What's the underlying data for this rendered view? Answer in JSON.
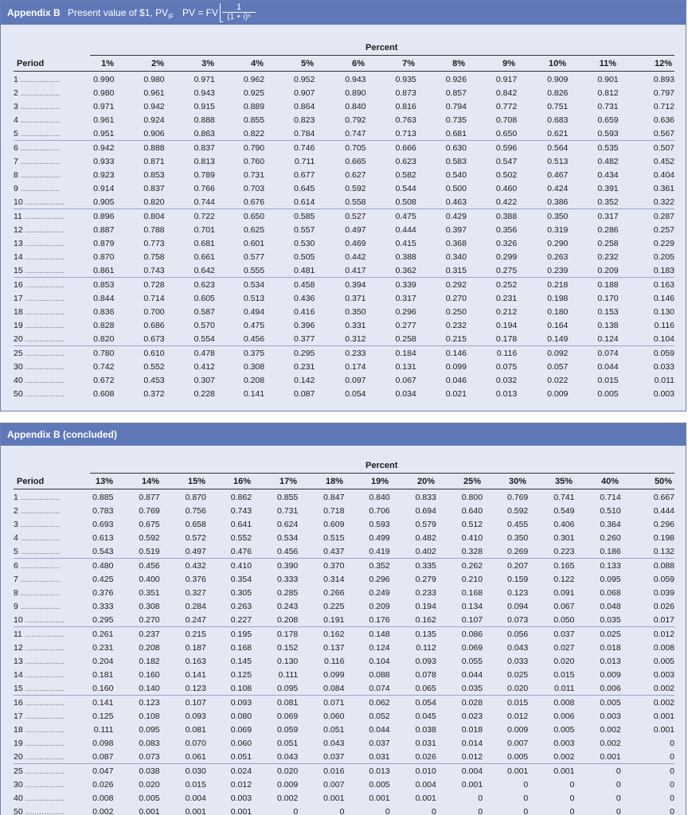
{
  "appendix1": {
    "title": "Appendix B",
    "subtitle": "Present value of $1, PV",
    "subtitle_sub": "IF",
    "formula_lhs": "PV = FV",
    "formula_num": "1",
    "formula_den": "(1 + i)ⁿ",
    "percent_label": "Percent",
    "period_label": "Period",
    "columns": [
      "1%",
      "2%",
      "3%",
      "4%",
      "5%",
      "6%",
      "7%",
      "8%",
      "9%",
      "10%",
      "11%",
      "12%"
    ],
    "rows": [
      {
        "p": "1",
        "v": [
          "0.990",
          "0.980",
          "0.971",
          "0.962",
          "0.952",
          "0.943",
          "0.935",
          "0.926",
          "0.917",
          "0.909",
          "0.901",
          "0.893"
        ]
      },
      {
        "p": "2",
        "v": [
          "0.980",
          "0.961",
          "0.943",
          "0.925",
          "0.907",
          "0.890",
          "0.873",
          "0.857",
          "0.842",
          "0.826",
          "0.812",
          "0.797"
        ]
      },
      {
        "p": "3",
        "v": [
          "0.971",
          "0.942",
          "0.915",
          "0.889",
          "0.864",
          "0.840",
          "0.816",
          "0.794",
          "0.772",
          "0.751",
          "0.731",
          "0.712"
        ]
      },
      {
        "p": "4",
        "v": [
          "0.961",
          "0.924",
          "0.888",
          "0.855",
          "0.823",
          "0.792",
          "0.763",
          "0.735",
          "0.708",
          "0.683",
          "0.659",
          "0.636"
        ]
      },
      {
        "p": "5",
        "v": [
          "0.951",
          "0.906",
          "0.863",
          "0.822",
          "0.784",
          "0.747",
          "0.713",
          "0.681",
          "0.650",
          "0.621",
          "0.593",
          "0.567"
        ]
      },
      {
        "p": "6",
        "v": [
          "0.942",
          "0.888",
          "0.837",
          "0.790",
          "0.746",
          "0.705",
          "0.666",
          "0.630",
          "0.596",
          "0.564",
          "0.535",
          "0.507"
        ]
      },
      {
        "p": "7",
        "v": [
          "0.933",
          "0.871",
          "0.813",
          "0.760",
          "0.711",
          "0.665",
          "0.623",
          "0.583",
          "0.547",
          "0.513",
          "0.482",
          "0.452"
        ]
      },
      {
        "p": "8",
        "v": [
          "0.923",
          "0.853",
          "0.789",
          "0.731",
          "0.677",
          "0.627",
          "0.582",
          "0.540",
          "0.502",
          "0.467",
          "0.434",
          "0.404"
        ]
      },
      {
        "p": "9",
        "v": [
          "0.914",
          "0.837",
          "0.766",
          "0.703",
          "0.645",
          "0.592",
          "0.544",
          "0.500",
          "0.460",
          "0.424",
          "0.391",
          "0.361"
        ]
      },
      {
        "p": "10",
        "v": [
          "0.905",
          "0.820",
          "0.744",
          "0.676",
          "0.614",
          "0.558",
          "0.508",
          "0.463",
          "0.422",
          "0.386",
          "0.352",
          "0.322"
        ]
      },
      {
        "p": "11",
        "v": [
          "0.896",
          "0.804",
          "0.722",
          "0.650",
          "0.585",
          "0.527",
          "0.475",
          "0.429",
          "0.388",
          "0.350",
          "0.317",
          "0.287"
        ]
      },
      {
        "p": "12",
        "v": [
          "0.887",
          "0.788",
          "0.701",
          "0.625",
          "0.557",
          "0.497",
          "0.444",
          "0.397",
          "0.356",
          "0.319",
          "0.286",
          "0.257"
        ]
      },
      {
        "p": "13",
        "v": [
          "0.879",
          "0.773",
          "0.681",
          "0.601",
          "0.530",
          "0.469",
          "0.415",
          "0.368",
          "0.326",
          "0.290",
          "0.258",
          "0.229"
        ]
      },
      {
        "p": "14",
        "v": [
          "0.870",
          "0.758",
          "0.661",
          "0.577",
          "0.505",
          "0.442",
          "0.388",
          "0.340",
          "0.299",
          "0.263",
          "0.232",
          "0.205"
        ]
      },
      {
        "p": "15",
        "v": [
          "0.861",
          "0.743",
          "0.642",
          "0.555",
          "0.481",
          "0.417",
          "0.362",
          "0.315",
          "0.275",
          "0.239",
          "0.209",
          "0.183"
        ]
      },
      {
        "p": "16",
        "v": [
          "0.853",
          "0.728",
          "0.623",
          "0.534",
          "0.458",
          "0.394",
          "0.339",
          "0.292",
          "0.252",
          "0.218",
          "0.188",
          "0.163"
        ]
      },
      {
        "p": "17",
        "v": [
          "0.844",
          "0.714",
          "0.605",
          "0.513",
          "0.436",
          "0.371",
          "0.317",
          "0.270",
          "0.231",
          "0.198",
          "0.170",
          "0.146"
        ]
      },
      {
        "p": "18",
        "v": [
          "0.836",
          "0.700",
          "0.587",
          "0.494",
          "0.416",
          "0.350",
          "0.296",
          "0.250",
          "0.212",
          "0.180",
          "0.153",
          "0.130"
        ]
      },
      {
        "p": "19",
        "v": [
          "0.828",
          "0.686",
          "0.570",
          "0.475",
          "0.396",
          "0.331",
          "0.277",
          "0.232",
          "0.194",
          "0.164",
          "0.138",
          "0.116"
        ]
      },
      {
        "p": "20",
        "v": [
          "0.820",
          "0.673",
          "0.554",
          "0.456",
          "0.377",
          "0.312",
          "0.258",
          "0.215",
          "0.178",
          "0.149",
          "0.124",
          "0.104"
        ]
      },
      {
        "p": "25",
        "v": [
          "0.780",
          "0.610",
          "0.478",
          "0.375",
          "0.295",
          "0.233",
          "0.184",
          "0.146",
          "0.116",
          "0.092",
          "0.074",
          "0.059"
        ]
      },
      {
        "p": "30",
        "v": [
          "0.742",
          "0.552",
          "0.412",
          "0.308",
          "0.231",
          "0.174",
          "0.131",
          "0.099",
          "0.075",
          "0.057",
          "0.044",
          "0.033"
        ]
      },
      {
        "p": "40",
        "v": [
          "0.672",
          "0.453",
          "0.307",
          "0.208",
          "0.142",
          "0.097",
          "0.067",
          "0.046",
          "0.032",
          "0.022",
          "0.015",
          "0.011"
        ]
      },
      {
        "p": "50",
        "v": [
          "0.608",
          "0.372",
          "0.228",
          "0.141",
          "0.087",
          "0.054",
          "0.034",
          "0.021",
          "0.013",
          "0.009",
          "0.005",
          "0.003"
        ]
      }
    ]
  },
  "appendix2": {
    "title": "Appendix B (concluded)",
    "percent_label": "Percent",
    "period_label": "Period",
    "columns": [
      "13%",
      "14%",
      "15%",
      "16%",
      "17%",
      "18%",
      "19%",
      "20%",
      "25%",
      "30%",
      "35%",
      "40%",
      "50%"
    ],
    "rows": [
      {
        "p": "1",
        "v": [
          "0.885",
          "0.877",
          "0.870",
          "0.862",
          "0.855",
          "0.847",
          "0.840",
          "0.833",
          "0.800",
          "0.769",
          "0.741",
          "0.714",
          "0.667"
        ]
      },
      {
        "p": "2",
        "v": [
          "0.783",
          "0.769",
          "0.756",
          "0.743",
          "0.731",
          "0.718",
          "0.706",
          "0.694",
          "0.640",
          "0.592",
          "0.549",
          "0.510",
          "0.444"
        ]
      },
      {
        "p": "3",
        "v": [
          "0.693",
          "0.675",
          "0.658",
          "0.641",
          "0.624",
          "0.609",
          "0.593",
          "0.579",
          "0.512",
          "0.455",
          "0.406",
          "0.364",
          "0.296"
        ]
      },
      {
        "p": "4",
        "v": [
          "0.613",
          "0.592",
          "0.572",
          "0.552",
          "0.534",
          "0.515",
          "0.499",
          "0.482",
          "0.410",
          "0.350",
          "0.301",
          "0.260",
          "0.198"
        ]
      },
      {
        "p": "5",
        "v": [
          "0.543",
          "0.519",
          "0.497",
          "0.476",
          "0.456",
          "0.437",
          "0.419",
          "0.402",
          "0.328",
          "0.269",
          "0.223",
          "0.186",
          "0.132"
        ]
      },
      {
        "p": "6",
        "v": [
          "0.480",
          "0.456",
          "0.432",
          "0.410",
          "0.390",
          "0.370",
          "0.352",
          "0.335",
          "0.262",
          "0.207",
          "0.165",
          "0.133",
          "0.088"
        ]
      },
      {
        "p": "7",
        "v": [
          "0.425",
          "0.400",
          "0.376",
          "0.354",
          "0.333",
          "0.314",
          "0.296",
          "0.279",
          "0.210",
          "0.159",
          "0.122",
          "0.095",
          "0.059"
        ]
      },
      {
        "p": "8",
        "v": [
          "0.376",
          "0.351",
          "0.327",
          "0.305",
          "0.285",
          "0.266",
          "0.249",
          "0.233",
          "0.168",
          "0.123",
          "0.091",
          "0.068",
          "0.039"
        ]
      },
      {
        "p": "9",
        "v": [
          "0.333",
          "0.308",
          "0.284",
          "0.263",
          "0.243",
          "0.225",
          "0.209",
          "0.194",
          "0.134",
          "0.094",
          "0.067",
          "0.048",
          "0.026"
        ]
      },
      {
        "p": "10",
        "v": [
          "0.295",
          "0.270",
          "0.247",
          "0.227",
          "0.208",
          "0.191",
          "0.176",
          "0.162",
          "0.107",
          "0.073",
          "0.050",
          "0.035",
          "0.017"
        ]
      },
      {
        "p": "11",
        "v": [
          "0.261",
          "0.237",
          "0.215",
          "0.195",
          "0.178",
          "0.162",
          "0.148",
          "0.135",
          "0.086",
          "0.056",
          "0.037",
          "0.025",
          "0.012"
        ]
      },
      {
        "p": "12",
        "v": [
          "0.231",
          "0.208",
          "0.187",
          "0.168",
          "0.152",
          "0.137",
          "0.124",
          "0.112",
          "0.069",
          "0.043",
          "0.027",
          "0.018",
          "0.008"
        ]
      },
      {
        "p": "13",
        "v": [
          "0.204",
          "0.182",
          "0.163",
          "0.145",
          "0.130",
          "0.116",
          "0.104",
          "0.093",
          "0.055",
          "0.033",
          "0.020",
          "0.013",
          "0.005"
        ]
      },
      {
        "p": "14",
        "v": [
          "0.181",
          "0.160",
          "0.141",
          "0.125",
          "0.111",
          "0.099",
          "0.088",
          "0.078",
          "0.044",
          "0.025",
          "0.015",
          "0.009",
          "0.003"
        ]
      },
      {
        "p": "15",
        "v": [
          "0.160",
          "0.140",
          "0.123",
          "0.108",
          "0.095",
          "0.084",
          "0.074",
          "0.065",
          "0.035",
          "0.020",
          "0.011",
          "0.006",
          "0.002"
        ]
      },
      {
        "p": "16",
        "v": [
          "0.141",
          "0.123",
          "0.107",
          "0.093",
          "0.081",
          "0.071",
          "0.062",
          "0.054",
          "0.028",
          "0.015",
          "0.008",
          "0.005",
          "0.002"
        ]
      },
      {
        "p": "17",
        "v": [
          "0.125",
          "0.108",
          "0.093",
          "0.080",
          "0.069",
          "0.060",
          "0.052",
          "0.045",
          "0.023",
          "0.012",
          "0.006",
          "0.003",
          "0.001"
        ]
      },
      {
        "p": "18",
        "v": [
          "0.111",
          "0.095",
          "0.081",
          "0.069",
          "0.059",
          "0.051",
          "0.044",
          "0.038",
          "0.018",
          "0.009",
          "0.005",
          "0.002",
          "0.001"
        ]
      },
      {
        "p": "19",
        "v": [
          "0.098",
          "0.083",
          "0.070",
          "0.060",
          "0.051",
          "0.043",
          "0.037",
          "0.031",
          "0.014",
          "0.007",
          "0.003",
          "0.002",
          "0"
        ]
      },
      {
        "p": "20",
        "v": [
          "0.087",
          "0.073",
          "0.061",
          "0.051",
          "0.043",
          "0.037",
          "0.031",
          "0.026",
          "0.012",
          "0.005",
          "0.002",
          "0.001",
          "0"
        ]
      },
      {
        "p": "25",
        "v": [
          "0.047",
          "0.038",
          "0.030",
          "0.024",
          "0.020",
          "0.016",
          "0.013",
          "0.010",
          "0.004",
          "0.001",
          "0.001",
          "0",
          "0"
        ]
      },
      {
        "p": "30",
        "v": [
          "0.026",
          "0.020",
          "0.015",
          "0.012",
          "0.009",
          "0.007",
          "0.005",
          "0.004",
          "0.001",
          "0",
          "0",
          "0",
          "0"
        ]
      },
      {
        "p": "40",
        "v": [
          "0.008",
          "0.005",
          "0.004",
          "0.003",
          "0.002",
          "0.001",
          "0.001",
          "0.001",
          "0",
          "0",
          "0",
          "0",
          "0"
        ]
      },
      {
        "p": "50",
        "v": [
          "0.002",
          "0.001",
          "0.001",
          "0.001",
          "0",
          "0",
          "0",
          "0",
          "0",
          "0",
          "0",
          "0",
          "0"
        ]
      }
    ]
  },
  "colors": {
    "header_bar": "#5f78b8",
    "panel_bg": "#e3e8f4",
    "border": "#6b7fb0"
  }
}
